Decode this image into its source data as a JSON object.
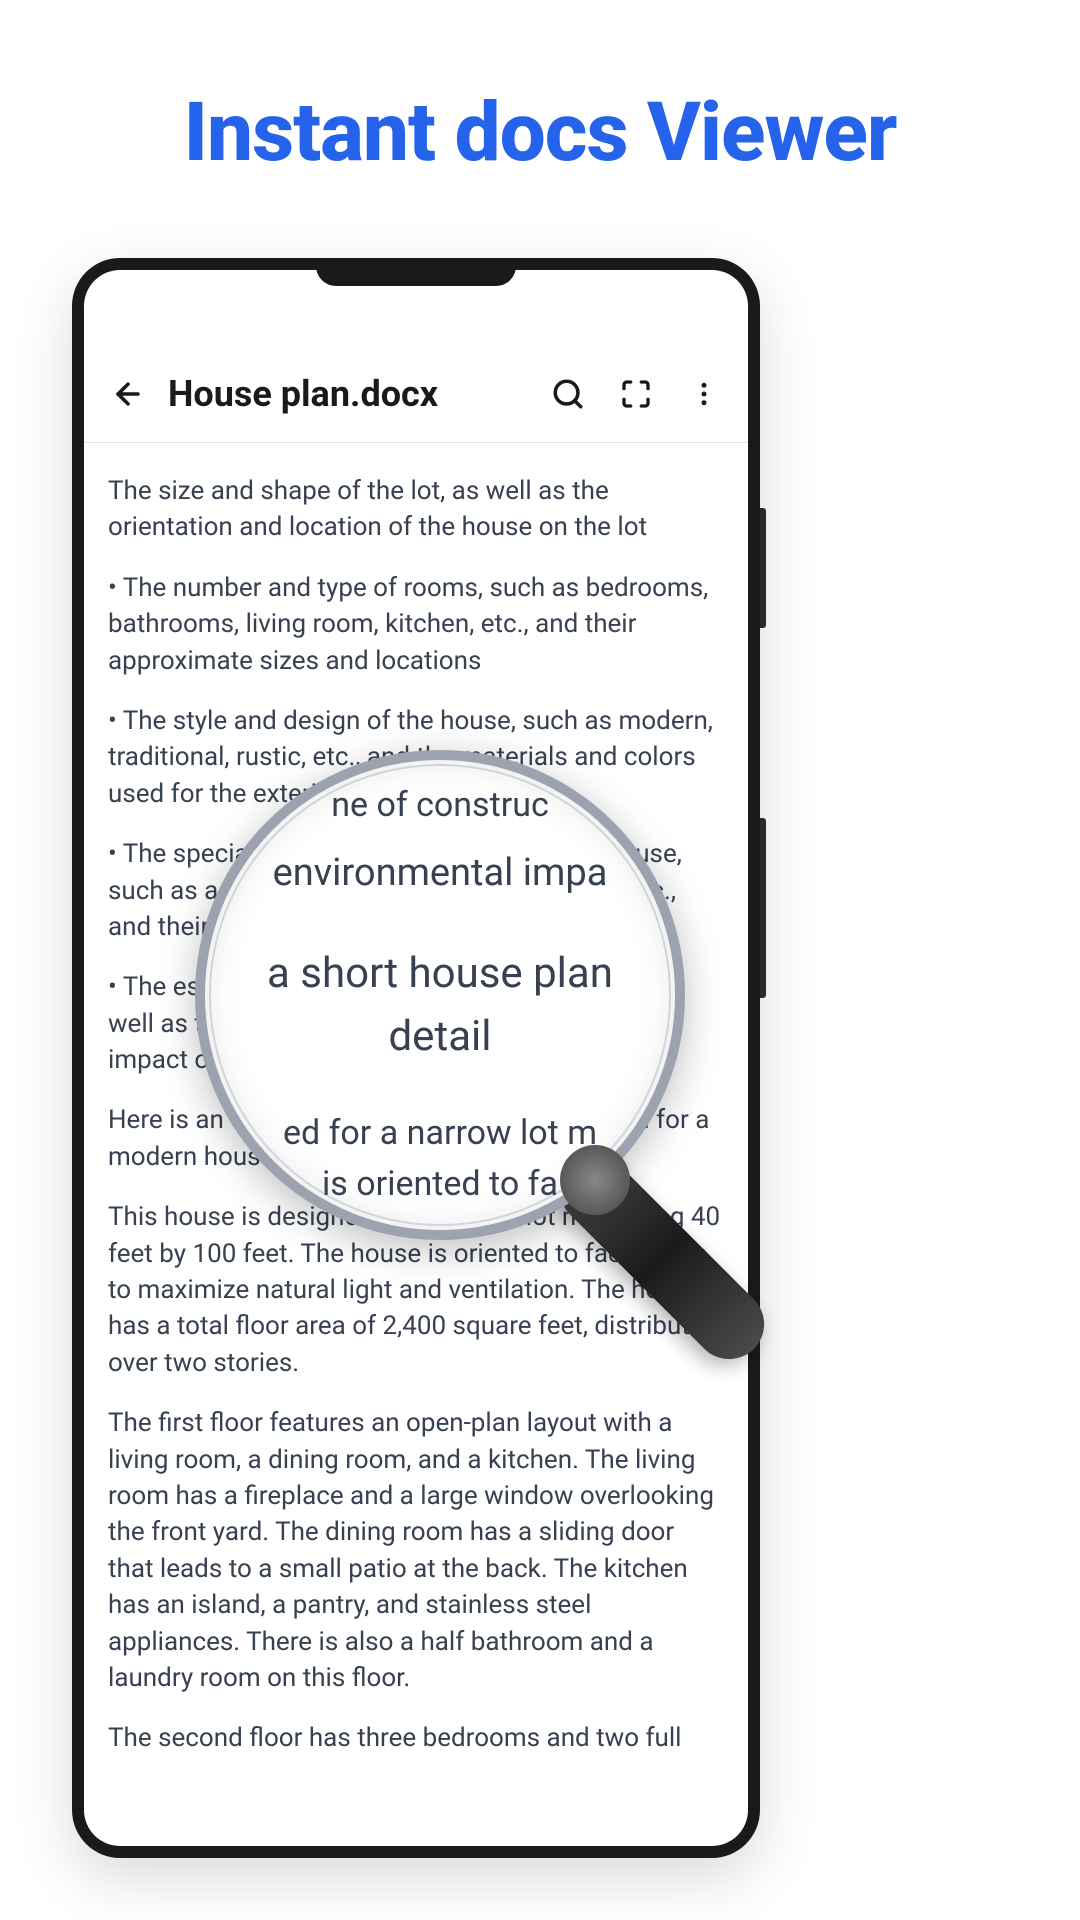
{
  "hero": {
    "title": "Instant docs Viewer"
  },
  "toolbar": {
    "document_title": "House plan.docx"
  },
  "document": {
    "paragraphs": {
      "intro": "The size and shape of the lot, as well as the orientation and location of the house on the lot",
      "bullet1": "•  The number and type of rooms, such as bedrooms, bathrooms, living room, kitchen, etc., and their approximate sizes and locations",
      "bullet2": "•  The style and design of the house, such as modern, traditional, rustic, etc., and the materials and colors used for the exterior and interior",
      "bullet3": "•  The special features and amenities of the house, such as a garage, a porch, a fireplace, a pool, etc., and their sizes and locations",
      "bullet4": "•  The estimated cost and time of construction, as well as the energy efficiency and environmental impact of the house",
      "example_intro": "Here is an example of a short house plan detail for a modern house:",
      "para1": "This house is designed for a narrow lot measuring 40 feet by 100 feet. The house is oriented to face south to maximize natural light and ventilation. The house has a total floor area of 2,400 square feet, distributed over two stories.",
      "para2": "The first floor features an open-plan layout with a living room, a dining room, and a kitchen. The living room has a fireplace and a large window overlooking the front yard. The dining room has a sliding door that leads to a small patio at the back. The kitchen has an island, a pantry, and stainless steel appliances. There is also a half bathroom and a laundry room on this floor.",
      "para3": "The second floor has three bedrooms and two full"
    }
  },
  "magnifier": {
    "line1": "ne of construc",
    "line2": "environmental impa",
    "line_center": "a short house plan detail",
    "line3": "ed for a narrow lot m",
    "line4": "is oriented to fa"
  }
}
